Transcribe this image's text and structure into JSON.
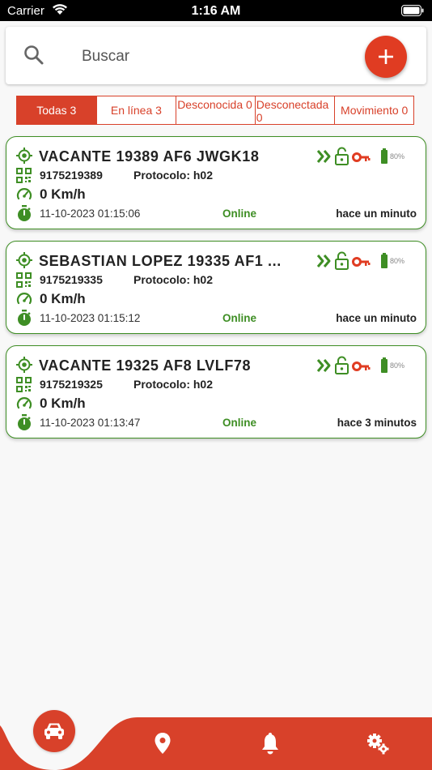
{
  "status_bar": {
    "carrier": "Carrier",
    "time": "1:16 AM"
  },
  "search": {
    "placeholder": "Buscar"
  },
  "colors": {
    "accent": "#d8412a",
    "online": "#3e8e24",
    "key": "#e03c22"
  },
  "filters": [
    {
      "label": "Todas 3",
      "active": true
    },
    {
      "label": "En línea 3",
      "active": false
    },
    {
      "label": "Desconocida 0",
      "active": false
    },
    {
      "label": "Desconectada 0",
      "active": false
    },
    {
      "label": "Movimiento 0",
      "active": false
    }
  ],
  "vehicles": [
    {
      "name": "VACANTE 19389 AF6 JWGK18",
      "imei": "9175219389",
      "protocol": "Protocolo: h02",
      "speed": "0 Km/h",
      "datetime": "11-10-2023 01:15:06",
      "status": "Online",
      "last_seen": "hace un minuto",
      "battery": "80%"
    },
    {
      "name": "SEBASTIAN LOPEZ 19335 AF1 ...",
      "imei": "9175219335",
      "protocol": "Protocolo: h02",
      "speed": "0 Km/h",
      "datetime": "11-10-2023 01:15:12",
      "status": "Online",
      "last_seen": "hace un minuto",
      "battery": "80%"
    },
    {
      "name": "VACANTE 19325 AF8 LVLF78",
      "imei": "9175219325",
      "protocol": "Protocolo: h02",
      "speed": "0 Km/h",
      "datetime": "11-10-2023 01:13:47",
      "status": "Online",
      "last_seen": "hace 3 minutos",
      "battery": "80%"
    }
  ],
  "bottom_nav": [
    {
      "icon": "car-icon",
      "active": true
    },
    {
      "icon": "map-pin-icon",
      "active": false
    },
    {
      "icon": "bell-icon",
      "active": false
    },
    {
      "icon": "gears-icon",
      "active": false
    }
  ]
}
